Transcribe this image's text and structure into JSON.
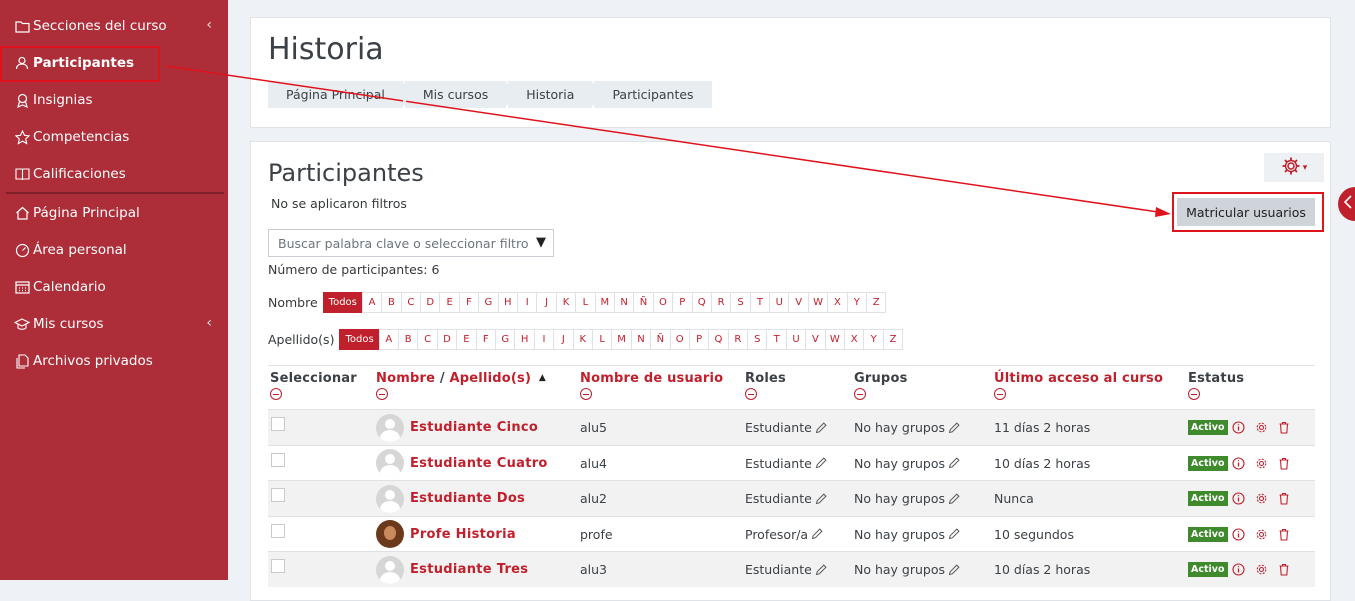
{
  "sidebar": {
    "items": [
      {
        "label": "Secciones del curso",
        "icon": "folder-icon",
        "chevron": "‹"
      },
      {
        "label": "Participantes",
        "icon": "users-icon"
      },
      {
        "label": "Insignias",
        "icon": "badge-icon"
      },
      {
        "label": "Competencias",
        "icon": "star-icon"
      },
      {
        "label": "Calificaciones",
        "icon": "grades-icon"
      },
      {
        "label": "Página Principal",
        "icon": "home-icon"
      },
      {
        "label": "Área personal",
        "icon": "dashboard-icon"
      },
      {
        "label": "Calendario",
        "icon": "calendar-icon"
      },
      {
        "label": "Mis cursos",
        "icon": "graduation-cap-icon",
        "chevron": "‹"
      },
      {
        "label": "Archivos privados",
        "icon": "files-icon"
      }
    ]
  },
  "header": {
    "title": "Historia",
    "breadcrumb": [
      "Página Principal",
      "Mis cursos",
      "Historia",
      "Participantes"
    ]
  },
  "main": {
    "title": "Participantes",
    "no_filters": "No se aplicaron filtros",
    "search_placeholder": "Buscar palabra clave o seleccionar filtro",
    "count": "Número de participantes: 6",
    "enrol_button": "Matricular usuarios",
    "name_label": "Nombre",
    "surname_label": "Apellido(s)",
    "all_label": "Todos",
    "letters": [
      "A",
      "B",
      "C",
      "D",
      "E",
      "F",
      "G",
      "H",
      "I",
      "J",
      "K",
      "L",
      "M",
      "N",
      "Ñ",
      "O",
      "P",
      "Q",
      "R",
      "S",
      "T",
      "U",
      "V",
      "W",
      "X",
      "Y",
      "Z"
    ]
  },
  "table": {
    "headers": {
      "select": "Seleccionar",
      "name": "Nombre",
      "name_sep": "/",
      "surname": "Apellido(s)",
      "sort_icon": "▲",
      "username": "Nombre de usuario",
      "roles": "Roles",
      "groups": "Grupos",
      "last_access": "Último acceso al curso",
      "status": "Estatus"
    },
    "rows": [
      {
        "name": "Estudiante Cinco",
        "username": "alu5",
        "role": "Estudiante",
        "groups": "No hay grupos",
        "last_access": "11 días 2 horas",
        "status": "Activo",
        "avatar": "default"
      },
      {
        "name": "Estudiante Cuatro",
        "username": "alu4",
        "role": "Estudiante",
        "groups": "No hay grupos",
        "last_access": "10 días 2 horas",
        "status": "Activo",
        "avatar": "default"
      },
      {
        "name": "Estudiante Dos",
        "username": "alu2",
        "role": "Estudiante",
        "groups": "No hay grupos",
        "last_access": "Nunca",
        "status": "Activo",
        "avatar": "default"
      },
      {
        "name": "Profe Historia",
        "username": "profe",
        "role": "Profesor/a",
        "groups": "No hay grupos",
        "last_access": "10 segundos",
        "status": "Activo",
        "avatar": "photo"
      },
      {
        "name": "Estudiante Tres",
        "username": "alu3",
        "role": "Estudiante",
        "groups": "No hay grupos",
        "last_access": "10 días 2 horas",
        "status": "Activo",
        "avatar": "default"
      }
    ]
  },
  "colors": {
    "sidebar": "#ad2e39",
    "accent": "#c0202c",
    "annotation": "#e0121c",
    "badge": "#3e8a2d"
  }
}
